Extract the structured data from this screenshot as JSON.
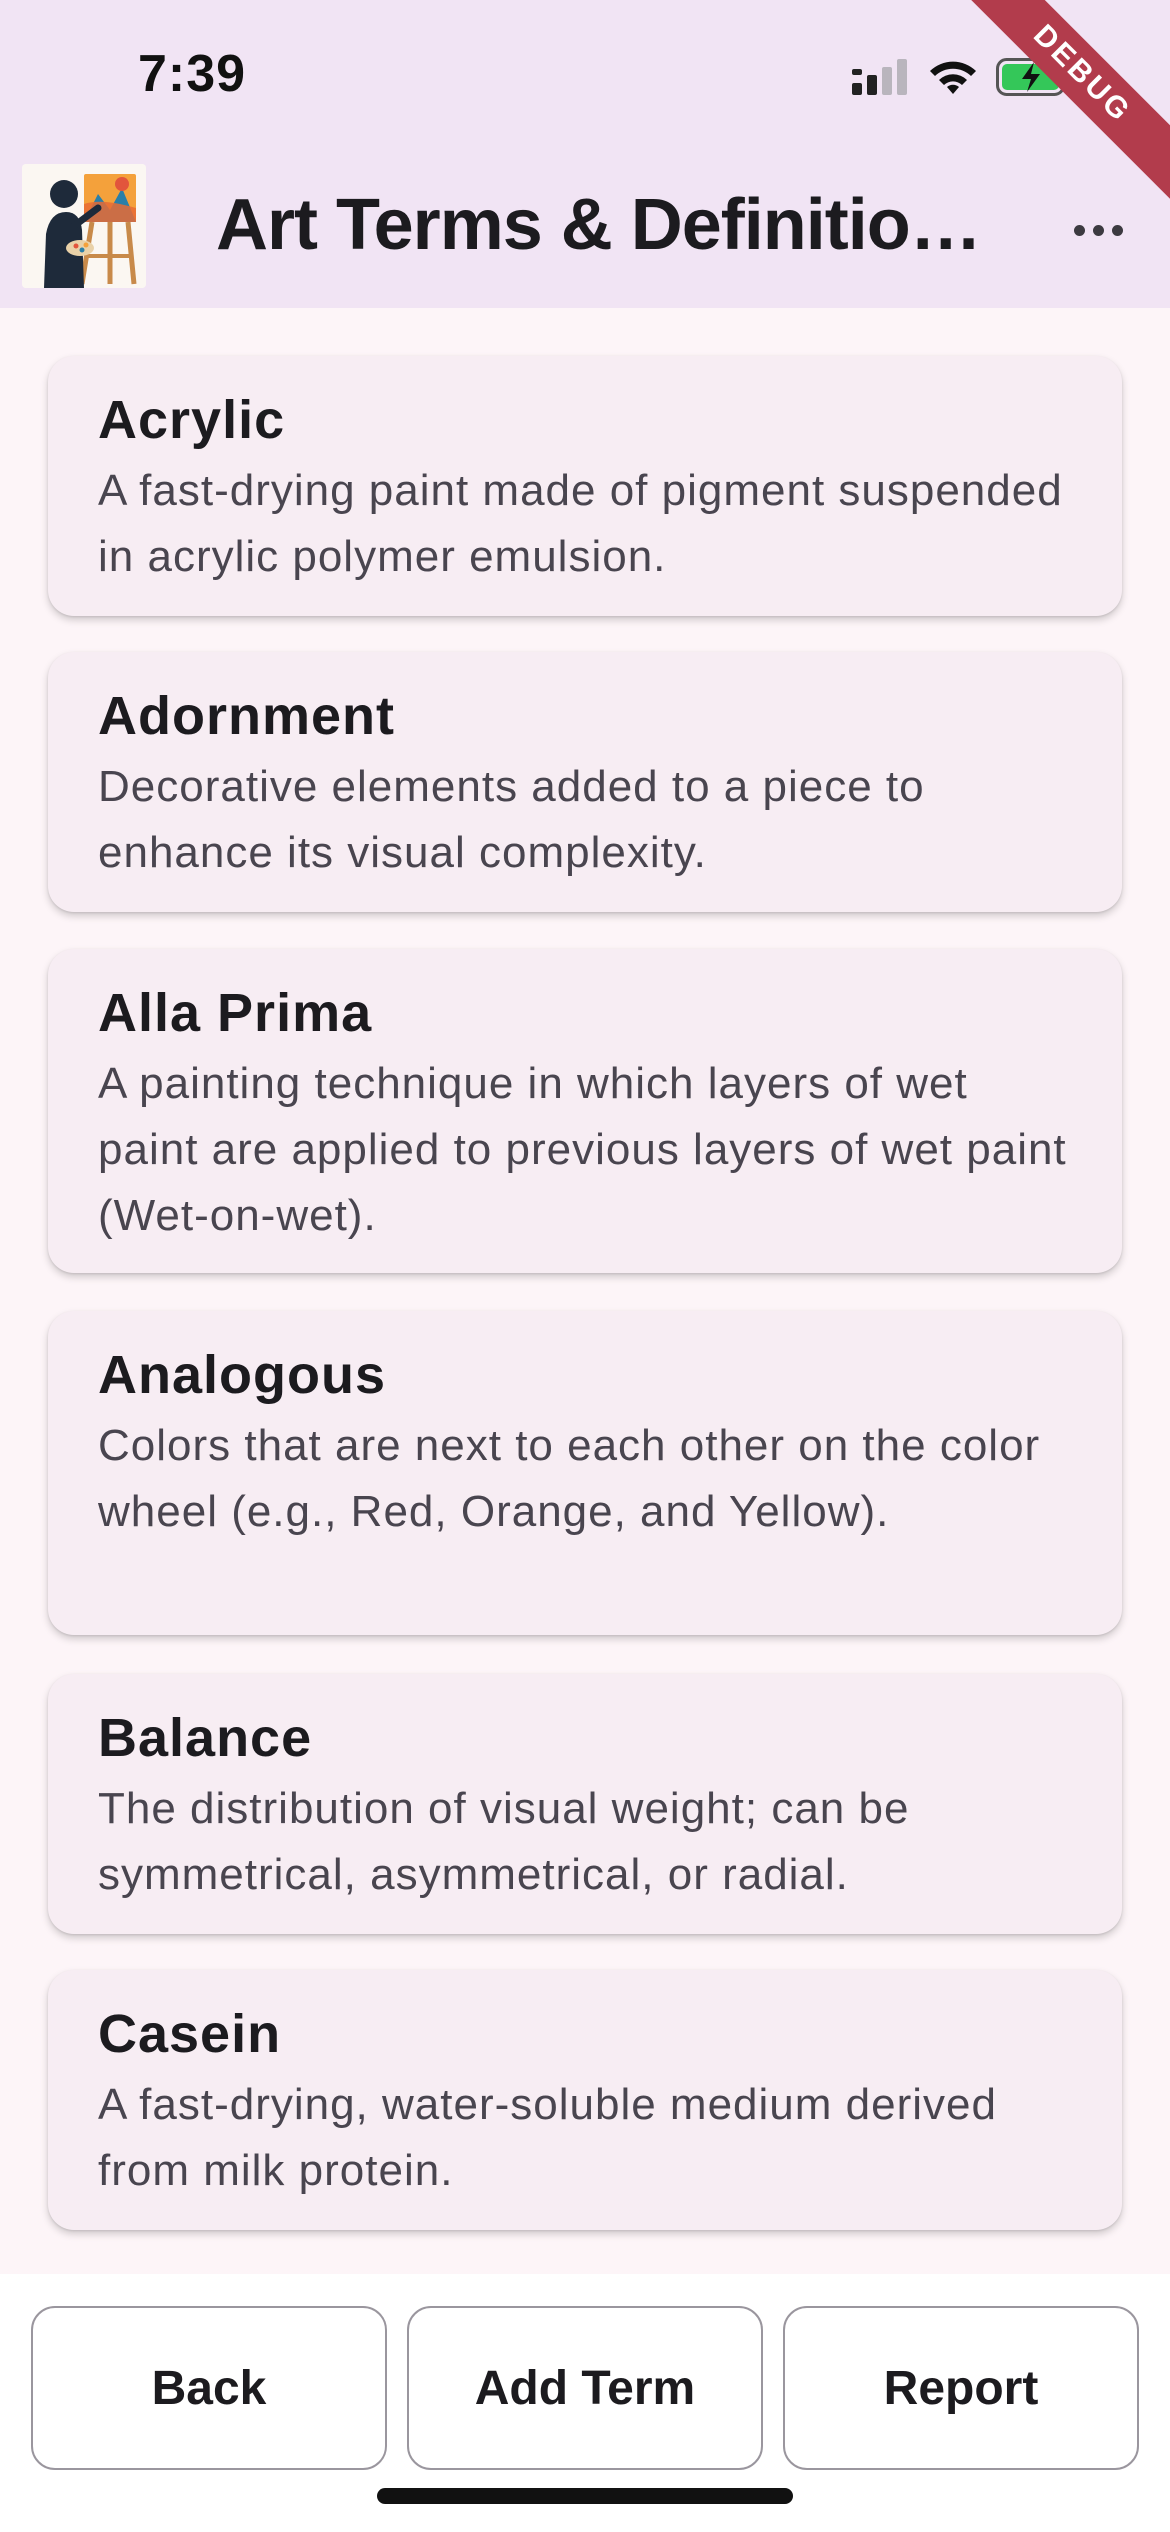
{
  "status_bar": {
    "time": "7:39",
    "debug_label": "DEBUG",
    "icons": [
      "signal-icon",
      "wifi-icon",
      "battery-charging-icon"
    ],
    "battery_color": "#34c759"
  },
  "app_bar": {
    "title": "Art Terms & Definitions",
    "logo": "painter-at-easel-logo",
    "more_icon": "more-horizontal-icon",
    "background": "#f1e4f4"
  },
  "terms": [
    {
      "name": "Acrylic",
      "definition": "A fast-drying paint made of pigment suspended in acrylic polymer emulsion."
    },
    {
      "name": "Adornment",
      "definition": "Decorative elements added to a piece to enhance its visual complexity."
    },
    {
      "name": "Alla Prima",
      "definition": "A painting technique in which layers of wet paint are applied to previous layers of wet paint (Wet-on-wet)."
    },
    {
      "name": "Analogous",
      "definition": "Colors that are next to each other on the color wheel (e.g., Red, Orange, and Yellow)."
    },
    {
      "name": "Balance",
      "definition": "The distribution of visual weight; can be symmetrical, asymmetrical, or radial."
    },
    {
      "name": "Casein",
      "definition": "A fast-drying, water-soluble medium derived from milk protein."
    }
  ],
  "bottom_bar": {
    "back_label": "Back",
    "add_term_label": "Add Term",
    "report_label": "Report"
  }
}
